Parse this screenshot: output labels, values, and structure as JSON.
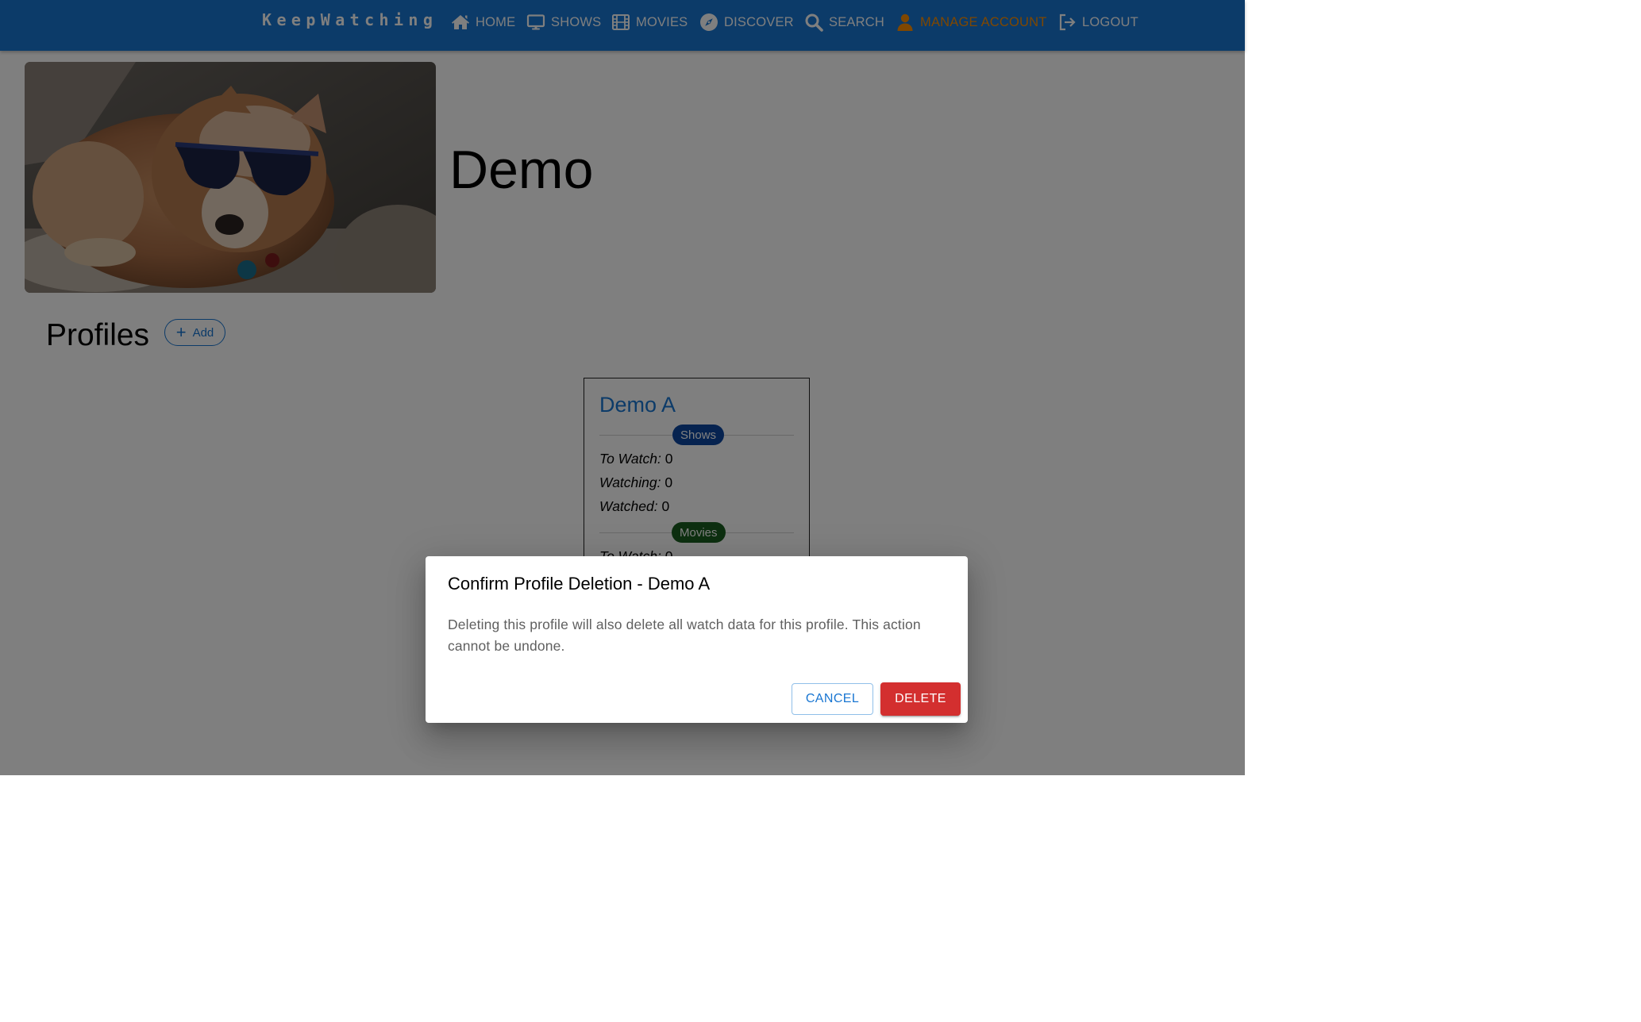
{
  "navbar": {
    "brand": "KeepWatching",
    "items": [
      {
        "label": "HOME",
        "icon": "home-icon"
      },
      {
        "label": "SHOWS",
        "icon": "tv-icon"
      },
      {
        "label": "MOVIES",
        "icon": "film-icon"
      },
      {
        "label": "DISCOVER",
        "icon": "compass-icon"
      },
      {
        "label": "SEARCH",
        "icon": "search-icon"
      },
      {
        "label": "MANAGE ACCOUNT",
        "icon": "user-icon",
        "active": true
      },
      {
        "label": "LOGOUT",
        "icon": "logout-icon"
      }
    ],
    "colors": {
      "background": "#1976d2",
      "active": "#ff8f00"
    }
  },
  "account": {
    "name": "Demo",
    "photo_description": "dog-wearing-sunglasses"
  },
  "profiles": {
    "title": "Profiles",
    "add_label": "Add",
    "cards": [
      {
        "name": "Demo A",
        "shows_chip": "Shows",
        "shows": [
          {
            "label": "To Watch:",
            "value": "0"
          },
          {
            "label": "Watching:",
            "value": "0"
          },
          {
            "label": "Watched:",
            "value": "0"
          }
        ],
        "movies_chip": "Movies",
        "movies": [
          {
            "label": "To Watch:",
            "value": "0"
          }
        ]
      }
    ]
  },
  "dialog": {
    "title": "Confirm Profile Deletion - Demo A",
    "message": "Deleting this profile will also delete all watch data for this profile. This action cannot be undone.",
    "cancel_label": "CANCEL",
    "delete_label": "DELETE",
    "colors": {
      "delete": "#d32f2f",
      "cancel": "#1976d2"
    }
  }
}
